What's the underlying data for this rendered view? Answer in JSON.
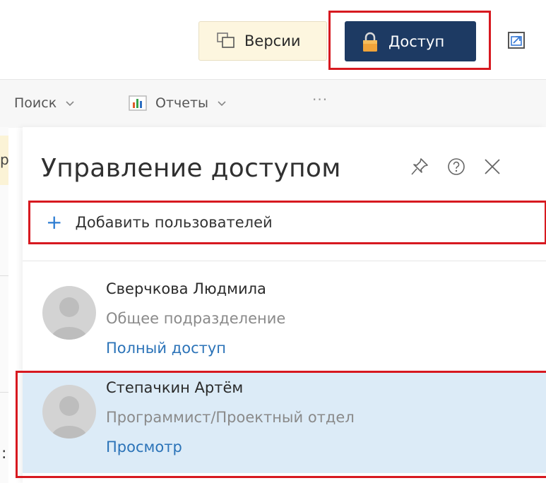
{
  "toolbar": {
    "versions_label": "Версии",
    "access_label": "Доступ"
  },
  "menu": {
    "search_label": "Поиск",
    "reports_label": "Отчеты",
    "more_label": "···"
  },
  "background": {
    "left_fragment": "р",
    "left_colon": ":"
  },
  "panel": {
    "title": "Управление доступом",
    "add_users_label": "Добавить пользователей",
    "add_icon": "+",
    "users": [
      {
        "name": "Сверчкова Людмила",
        "department": "Общее подразделение",
        "permission": "Полный доступ"
      },
      {
        "name": "Степачкин Артём",
        "department": "Программист/Проектный отдел",
        "permission": "Просмотр"
      }
    ]
  },
  "colors": {
    "access_button_bg": "#1d3a63",
    "versions_button_bg": "#fdf6df",
    "highlight_red": "#d71920",
    "link_blue": "#2b73b8",
    "selected_row_bg": "#dcebf7"
  },
  "icons": [
    "versions-icon",
    "lock-icon",
    "popout-icon",
    "reports-icon",
    "chevron-down-icon",
    "pin-icon",
    "help-icon",
    "close-icon",
    "plus-icon",
    "avatar-icon"
  ]
}
